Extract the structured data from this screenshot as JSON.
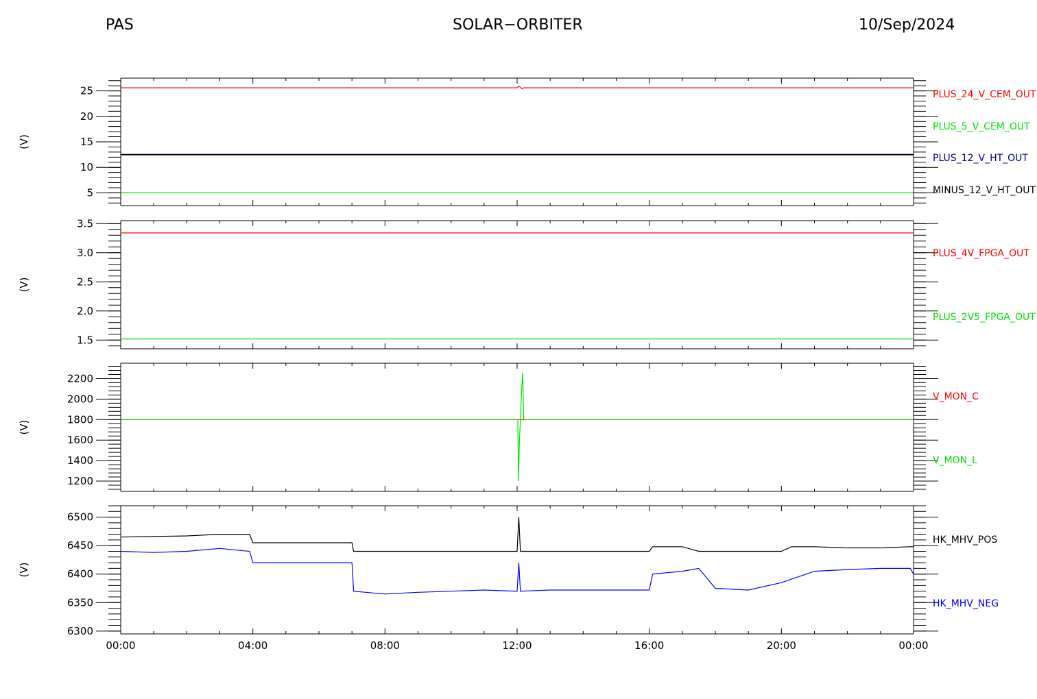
{
  "header": {
    "left": "PAS",
    "center": "SOLAR−ORBITER",
    "right": "10/Sep/2024"
  },
  "x_axis": {
    "ticks": [
      "00:00",
      "04:00",
      "08:00",
      "12:00",
      "16:00",
      "20:00",
      "00:00"
    ],
    "range_hours": [
      0,
      24
    ]
  },
  "colors": {
    "red": "#ff0000",
    "green": "#00e000",
    "navy": "#000080",
    "blue": "#0000ff",
    "black": "#000000"
  },
  "chart_data": [
    {
      "type": "line",
      "ylabel": "(V)",
      "ylim": [
        2.5,
        27.5
      ],
      "yticks": [
        5,
        10,
        15,
        20,
        25
      ],
      "series": [
        {
          "name": "PLUS_24_V_CEM_OUT",
          "color": "#ff0000",
          "x": [
            0,
            12.0,
            12.05,
            12.1,
            12.15,
            12.2,
            24
          ],
          "y": [
            25.6,
            25.6,
            25.9,
            25.7,
            25.4,
            25.6,
            25.6
          ]
        },
        {
          "name": "PLUS_5_V_CEM_OUT",
          "color": "#00e000",
          "x": [
            0,
            24
          ],
          "y": [
            5.0,
            5.0
          ]
        },
        {
          "name": "PLUS_12_V_HT_OUT",
          "color": "#000080",
          "x": [
            0,
            24
          ],
          "y": [
            12.5,
            12.5
          ]
        },
        {
          "name": "MINUS_12_V_HT_OUT",
          "color": "#000000",
          "x": [
            0,
            24
          ],
          "y": [
            12.5,
            12.5
          ]
        }
      ]
    },
    {
      "type": "line",
      "ylabel": "(V)",
      "ylim": [
        1.35,
        3.55
      ],
      "yticks": [
        1.5,
        2.0,
        2.5,
        3.0,
        3.5
      ],
      "series": [
        {
          "name": "PLUS_4V_FPGA_OUT",
          "color": "#ff0000",
          "x": [
            0,
            24
          ],
          "y": [
            3.34,
            3.34
          ]
        },
        {
          "name": "PLUS_2V5_FPGA_OUT",
          "color": "#00e000",
          "x": [
            0,
            24
          ],
          "y": [
            1.52,
            1.52
          ]
        }
      ]
    },
    {
      "type": "line",
      "ylabel": "(V)",
      "ylim": [
        1100,
        2350
      ],
      "yticks": [
        1200,
        1400,
        1600,
        1800,
        2000,
        2200
      ],
      "series": [
        {
          "name": "V_MON_C",
          "color": "#ff0000",
          "x": [
            0,
            24
          ],
          "y": [
            1800,
            1800
          ]
        },
        {
          "name": "V_MON_L",
          "color": "#00e000",
          "x": [
            0,
            12.02,
            12.04,
            12.07,
            12.1,
            12.14,
            12.17,
            12.2,
            24
          ],
          "y": [
            1800,
            1800,
            1200,
            1600,
            1800,
            2100,
            2260,
            1800,
            1800
          ]
        }
      ]
    },
    {
      "type": "line",
      "ylabel": "(V)",
      "ylim": [
        6295,
        6520
      ],
      "yticks": [
        6300,
        6350,
        6400,
        6450,
        6500
      ],
      "series": [
        {
          "name": "HK_MHV_POS",
          "color": "#000000",
          "x": [
            0,
            1,
            2,
            3,
            3.9,
            4.0,
            5,
            6,
            7.0,
            7.05,
            8,
            9,
            10,
            11,
            12.0,
            12.05,
            12.1,
            13,
            14,
            15,
            16,
            16.1,
            17,
            17.5,
            18,
            19,
            20,
            20.3,
            21,
            22,
            23,
            23.9,
            24
          ],
          "y": [
            6465,
            6466,
            6467,
            6470,
            6470,
            6455,
            6455,
            6455,
            6455,
            6440,
            6440,
            6440,
            6440,
            6440,
            6440,
            6500,
            6440,
            6440,
            6440,
            6440,
            6440,
            6448,
            6448,
            6440,
            6440,
            6440,
            6440,
            6448,
            6448,
            6446,
            6446,
            6448,
            6448
          ]
        },
        {
          "name": "HK_MHV_NEG",
          "color": "#0000ff",
          "x": [
            0,
            1,
            2,
            3,
            3.9,
            4.0,
            5,
            6,
            7.0,
            7.05,
            8,
            9,
            10,
            11,
            12.0,
            12.05,
            12.1,
            13,
            14,
            15,
            16,
            16.1,
            17,
            17.5,
            18,
            19,
            20,
            21,
            22,
            23,
            23.9,
            24
          ],
          "y": [
            6440,
            6438,
            6440,
            6445,
            6440,
            6420,
            6420,
            6420,
            6420,
            6370,
            6365,
            6368,
            6370,
            6372,
            6370,
            6420,
            6370,
            6372,
            6372,
            6372,
            6372,
            6400,
            6405,
            6410,
            6375,
            6372,
            6385,
            6405,
            6408,
            6410,
            6410,
            6400
          ]
        }
      ]
    }
  ]
}
